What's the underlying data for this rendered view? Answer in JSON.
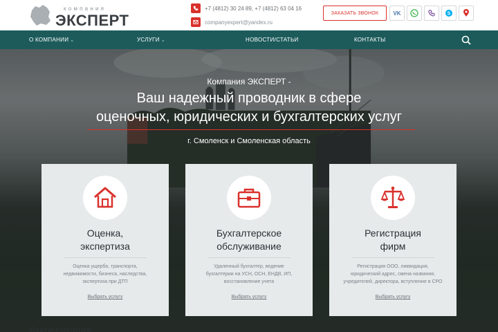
{
  "header": {
    "logo": {
      "small": "компания",
      "big": "ЭКСПЕРТ"
    },
    "phone": "+7 (4812) 30 24 89, +7 (4812) 63 04 16",
    "email": "companyexpert@yandex.ru",
    "call_button": "ЗАКАЗАТЬ ЗВОНОК",
    "social_icons": [
      "vk-icon",
      "whatsapp-icon",
      "viber-icon",
      "skype-icon",
      "location-pin-icon"
    ]
  },
  "nav": {
    "items": [
      {
        "label": "О КОМПАНИИ",
        "dropdown": true
      },
      {
        "label": "УСЛУГИ",
        "dropdown": true
      },
      {
        "label": "НОВОСТИ/СТАТЬИ",
        "dropdown": false
      },
      {
        "label": "КОНТАКТЫ",
        "dropdown": false
      }
    ]
  },
  "hero": {
    "subtitle": "Компания ЭКСПЕРТ -",
    "title_line1": "Ваш надежный проводник в сфере",
    "title_line2": "оценочных, юридических и бухгалтерских услуг",
    "region": "г. Смоленск и Смоленская область"
  },
  "cards": [
    {
      "icon": "house-icon",
      "title_line1": "Оценка,",
      "title_line2": "экспертиза",
      "desc_lines": [
        "Оценка ущерба, транспорта,",
        "недвижимости, бизнеса, наследства,",
        "экспертиза при ДТП"
      ],
      "link": "Выбрать услугу"
    },
    {
      "icon": "briefcase-icon",
      "title_line1": "Бухгалтерское",
      "title_line2": "обслуживание",
      "desc_lines": [
        "Удаленный бухгалтер, ведение",
        "бухгалтерии на УСН, ОСН, ЕНДВ, ИП,",
        "восстановление учета"
      ],
      "link": "Выбрать услугу"
    },
    {
      "icon": "scales-icon",
      "title_line1": "Регистрация",
      "title_line2": "фирм",
      "desc_lines": [
        "Регистрация ООО, ликвидация,",
        "юридический адрес, смена названия,",
        "учредителей, директора, вступление в СРО"
      ],
      "link": "Выбрать услугу"
    }
  ],
  "accreditation": "Аккредитация",
  "colors": {
    "accent": "#d9312c",
    "nav": "#1d5b5b",
    "card": "#e6eaeb"
  }
}
